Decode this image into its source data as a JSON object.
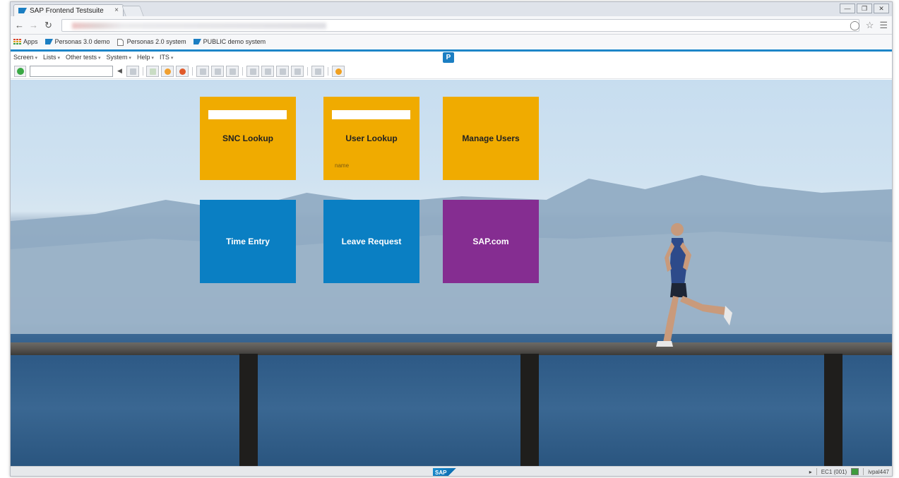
{
  "browser": {
    "tab_title": "SAP Frontend Testsuite",
    "tab_close": "×",
    "bookmarks": [
      {
        "label": "Apps"
      },
      {
        "label": "Personas 3.0 demo"
      },
      {
        "label": "Personas 2.0 system"
      },
      {
        "label": "PUBLIC demo system"
      }
    ]
  },
  "sap": {
    "menu": [
      "Screen",
      "Lists",
      "Other tests",
      "System",
      "Help",
      "ITS"
    ],
    "personas_icon": "P"
  },
  "tiles": [
    {
      "label": "SNC Lookup",
      "color": "#f0ab00",
      "has_input": true
    },
    {
      "label": "User Lookup",
      "color": "#f0ab00",
      "has_input": true,
      "sublabel": "name"
    },
    {
      "label": "Manage Users",
      "color": "#f0ab00"
    },
    {
      "label": "Time Entry",
      "color": "#0a7fc3"
    },
    {
      "label": "Leave Request",
      "color": "#0a7fc3"
    },
    {
      "label": "SAP.com",
      "color": "#852d91"
    }
  ],
  "status": {
    "logo": "SAP",
    "system": "EC1 (001)",
    "server": "ivpal447"
  },
  "colors": {
    "accent_bar": "#1d85c8",
    "tile_orange": "#f0ab00",
    "tile_blue": "#0a7fc3",
    "tile_purple": "#852d91"
  }
}
